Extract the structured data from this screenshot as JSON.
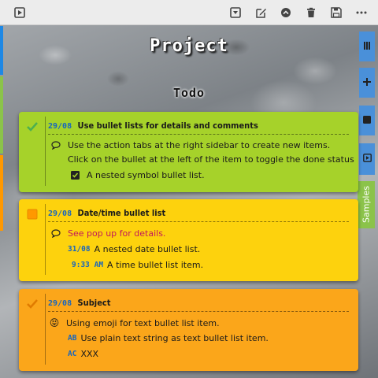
{
  "toolbar": {
    "left_icon": "play-box-icon",
    "right_icons": [
      "dropdown-box-icon",
      "edit-icon",
      "collapse-up-icon",
      "trash-icon",
      "save-icon",
      "more-icon"
    ]
  },
  "sidebar": {
    "tabs": [
      "menu-icon",
      "plus-icon",
      "stop-icon",
      "play-box-icon"
    ],
    "samples_label": "Samples"
  },
  "page": {
    "project_title": "Project",
    "section_title": "Todo"
  },
  "cards": [
    {
      "color": "#a6d22a",
      "check": "checked",
      "date": "29/08",
      "title": "Use bullet lists for details and comments",
      "comment_line1": "Use the action tabs at the right sidebar to create new items.",
      "comment_line2": "Click on the bullet at the left of the item to toggle the done status",
      "nested": "A nested symbol bullet list."
    },
    {
      "color": "#fdd20d",
      "check": "unchecked",
      "date": "29/08",
      "title": "Date/time bullet list",
      "comment": "See pop up for details.",
      "nested_date": "31/08",
      "nested_date_text": "A nested date bullet list.",
      "nested_time": "9:33 AM",
      "nested_time_text": "A time bullet list item."
    },
    {
      "color": "#fba61a",
      "check": "checked",
      "date": "29/08",
      "title": "Subject",
      "emoji": "😝",
      "emoji_text": "Using emoji for text bullet list item.",
      "tag1": "AB",
      "tag1_text": "Use plain text string as text bullet list item.",
      "tag2": "AC",
      "tag2_text": "XXX"
    }
  ]
}
